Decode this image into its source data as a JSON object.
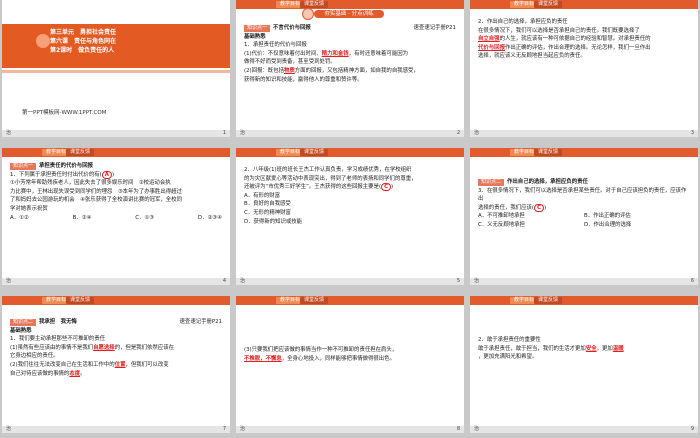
{
  "tabs": {
    "t1": "教学目标",
    "t2": "课堂反馈"
  },
  "footer_left": "治",
  "slides": [
    {
      "unit": "第三单元　勇担社会责任",
      "lesson": "第六课　责任与角色同在",
      "period": "第2课时　做负责任的人",
      "site": "第一PPT模板网-WWW.1PPT.COM",
      "page": "1"
    },
    {
      "banner": "夯实基础",
      "banner2": "· 分点训练",
      "tag": "知识点一",
      "heading": "不言代价与回报",
      "ref": "速查速记手册P21",
      "basic": "基础熟悉",
      "l1": "1．承担责任的代价与回报",
      "l2a": "(1)代价：不仅意味着付出时间、",
      "l2b": "精力和金钱",
      "l2c": "，有时还意味着可能因为",
      "l3": "做得不好而受到责备，甚至受到处罚。",
      "l4a": "(2)回报：既包括",
      "l4b": "物质",
      "l4c": "方面的回报，又包括精神方面，如自我的自我感受，",
      "l5": "获得新的知识和技能，赢得他人的尊重和赞许等。",
      "page": "2"
    },
    {
      "l1": "2．作出自己的选择，承担应负的责任",
      "l2": "在很多情况下，我们可以选择是否承担自己的责任。我们既要选择了",
      "l3a": "自立自强",
      "l3b": "的人生，就应该有一种可依据自己的经验和智慧。对承担责任的",
      "l4a": "代价与回报",
      "l4b": "作出正确的评估，作出合理的选择。无论怎样，我们一旦作出",
      "l5": "选择，就应该义无反顾地担当起应负的责任。",
      "page": "3"
    },
    {
      "tag": "知识点一",
      "heading": "承担责任的代价与回报",
      "q": "1．下列属于承担责任时付出代价的有(",
      "ans": "A",
      "q_end": ")",
      "o1": "①小芳常年帮助残疾老人，因此失去了很多娱乐时间　②校运动会执",
      "o2": "力比赛中，王林出现失误受到同学们的埋怨　③本年为了办事胜出得超过",
      "o3": "了和妈妈去公园游玩的机会　④张乐获得了全校演讲比赛的冠军，全校同",
      "o4": "学对她表示祝贺",
      "choices": [
        "A．①②",
        "B．②④",
        "C．①③",
        "D．②③④"
      ],
      "page": "4"
    },
    {
      "s1": "2．八年级(1)班的班长王杰工作认真负责，学习成绩优秀，在学校组织",
      "s2": "的为灾区献爱心等活动中表现突出，得到了老师的表扬和同学们的尊重，",
      "s3": "还被评为“市优秀三好学生”。王杰获得的这些回报主要是(",
      "ans": "C",
      "s3_end": ")",
      "choices": [
        "A．有形的财富",
        "B．良好的自我感受",
        "C．无形的精神财富",
        "D．获得新的知识或技能"
      ],
      "page": "5"
    },
    {
      "tag": "知识点二",
      "heading": "作出自己的选择，承担应负的责任",
      "q1": "3．在很多情况下，我们可以选择是否承担某些责任。对于自己应该担负的责任，应该作出",
      "q2": "选择的责任，我们应该(",
      "ans": "C",
      "q_end": ")",
      "choices": [
        "A．不可推卸地承担",
        "B．作出正确的评估",
        "C．义无反顾地承担",
        "D．作出合理的选择"
      ],
      "page": "6"
    },
    {
      "tag": "知识点二",
      "heading": "我承担　我无悔",
      "ref": "速查速记手册P21",
      "basic": "基础熟悉",
      "l1": "1．我们要主动承担那些不可推卸的责任",
      "l2a": "(1)虽然有些应该由的事情不是我们",
      "l2b": "自愿选择",
      "l2c": "的，但是我们依然应该在",
      "l3": "它身边相应的责任。",
      "l4a": "(2)我们往往无法改变自己在生活和工作中的",
      "l4b": "位置",
      "l4c": "，但我们可以改变",
      "l5a": "自己对待应该做的事情的",
      "l5b": "态度",
      "l5c": "。",
      "page": "7"
    },
    {
      "l1": "(3)只要我们把应该做的事情当作一种不可推卸的责任担在肩头，",
      "l2a": "不推脱，不懈怠",
      "l2b": "，全身心地投入，同样能够把事情做得很出色。",
      "page": "8"
    },
    {
      "l1": "2．敢于承担责任的重要性",
      "l2a": "敢于承担责任，敢于担当，我们的生活才更加",
      "l2b": "安全",
      "l2c": "，更加",
      "l2d": "温暖",
      "l3": "，更加充满阳光和希望。",
      "page": "9"
    }
  ],
  "colors": {
    "accent": "#e25b2d",
    "answer": "#e02020",
    "background": "#c9c9c9"
  }
}
